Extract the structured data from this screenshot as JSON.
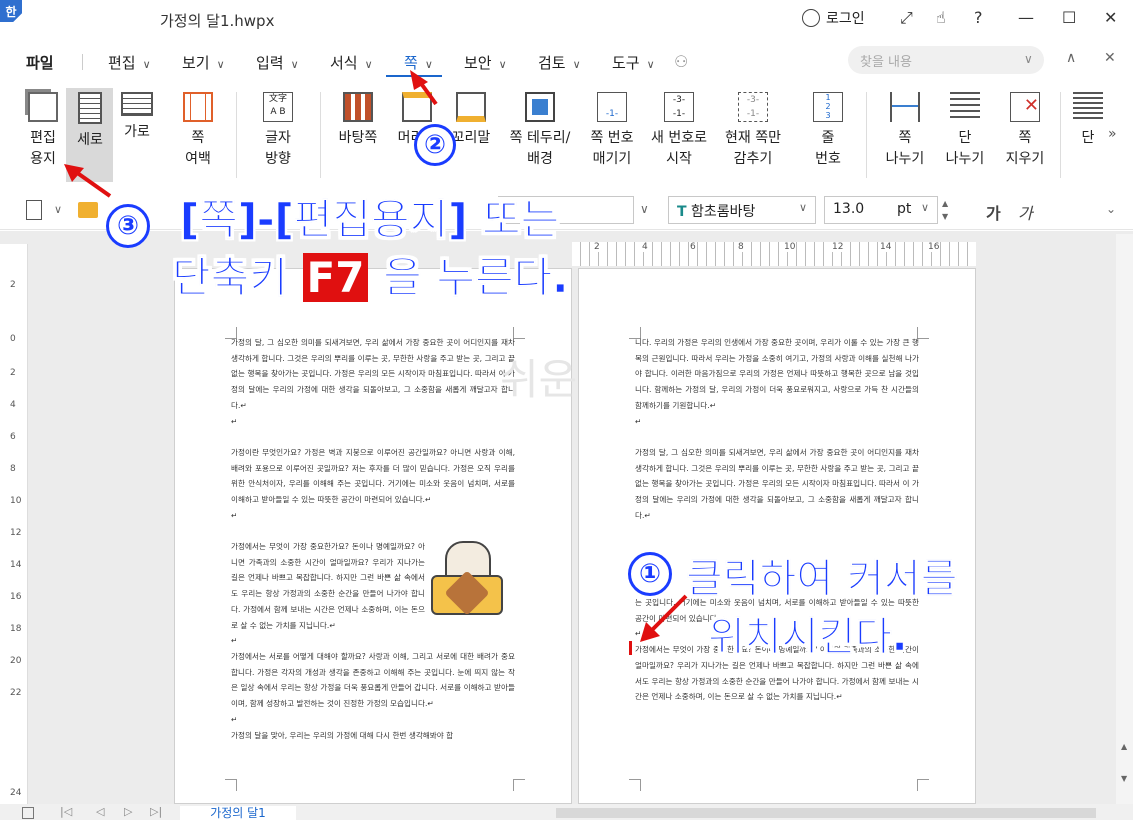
{
  "titlebar": {
    "app_icon": "한",
    "title": "가정의 달1.hwpx",
    "login": "로그인",
    "help": "?"
  },
  "menus": [
    "파일",
    "편집",
    "보기",
    "입력",
    "서식",
    "쪽",
    "보안",
    "검토",
    "도구"
  ],
  "search_placeholder": "찾을 내용",
  "ribbon": {
    "items": [
      {
        "label": "편집\n용지",
        "icon": "edit-paper-icon"
      },
      {
        "label": "세로",
        "icon": "portrait-icon"
      },
      {
        "label": "가로",
        "icon": "landscape-icon"
      },
      {
        "label": "쪽\n여백",
        "icon": "page-margin-icon"
      },
      {
        "label": "글자\n방향",
        "icon": "text-direction-icon"
      },
      {
        "label": "바탕쪽",
        "icon": "master-page-icon"
      },
      {
        "label": "머리말",
        "icon": "header-icon"
      },
      {
        "label": "꼬리말",
        "icon": "footer-icon"
      },
      {
        "label": "쪽 테두리/\n배경",
        "icon": "page-border-icon"
      },
      {
        "label": "쪽 번호\n매기기",
        "icon": "page-number-icon"
      },
      {
        "label": "새 번호로\n시작",
        "icon": "new-number-icon"
      },
      {
        "label": "현재 쪽만\n감추기",
        "icon": "hide-page-icon"
      },
      {
        "label": "줄\n번호",
        "icon": "line-number-icon"
      },
      {
        "label": "쪽\n나누기",
        "icon": "page-break-icon"
      },
      {
        "label": "단\n나누기",
        "icon": "column-break-icon"
      },
      {
        "label": "쪽\n지우기",
        "icon": "delete-page-icon"
      },
      {
        "label": "단",
        "icon": "columns-icon"
      }
    ]
  },
  "format": {
    "font": "함초롬바탕",
    "size": "13.0",
    "unit": "pt",
    "bold": "가",
    "italic": "가"
  },
  "ruler": {
    "h": [
      "2",
      "4",
      "6",
      "8",
      "10",
      "12",
      "14",
      "16"
    ],
    "v": [
      "2",
      "0",
      "2",
      "4",
      "6",
      "8",
      "10",
      "12",
      "14",
      "16",
      "18",
      "20",
      "22",
      "24"
    ]
  },
  "page1": {
    "p1": "가정의 달, 그 심오한 의미를 되새겨보면, 우리 삶에서 가장 중요한 곳이 어디인지를 재차 생각하게 합니다. 그것은 우리의 뿌리를 이루는 곳, 무한한 사랑을 주고 받는 곳, 그리고 끝없는 행복을 찾아가는 곳입니다. 가정은 우리의 모든 시작이자 마침표입니다. 따라서 이 가정의 달에는 우리의 가정에 대한 생각을 되돌아보고, 그 소중함을 새롭게 깨달고자 합니다.↵\n↵",
    "p2": "가정이란 무엇인가요? 가정은 벽과 지붕으로 이루어진 공간일까요? 아니면 사랑과 이해, 배려와 포용으로 이루어진 곳일까요? 저는 후자를 더 많이 믿습니다. 가정은 오직 우리를 위한 안식처이자, 우리를 이해해 주는 곳입니다. 거기에는 미소와 웃음이 넘치며, 서로를 이해하고 받아들일 수 있는 따뜻한 공간이 마련되어 있습니다.↵\n↵",
    "p3": "가정에서는 무엇이 가장 중요한가요? 돈이나 명예일까요? 아니면 가족과의 소중한 시간이 얼마일까요? 우리가 지나가는 길은 언제나 바쁘고 복잡합니다. 하지만 그런 바쁜 삶 속에서도 우리는 항상 가정과의 소중한 순간을 만들어 나가야 합니다. 가정에서 함께 보내는 시간은 언제나 소중하며, 이는 돈으로 살 수 없는 가치를 지닙니다.↵\n↵",
    "p4": "가정에서는 서로를 어떻게 대해야 할까요? 사랑과 이해, 그리고 서로에 대한 배려가 중요합니다. 가정은 각자의 개성과 생각을 존중하고 이해해 주는 곳입니다. 눈에 띄지 않는 작은 일상 속에서 우리는 항상 가정을 더욱 풍요롭게 만들어 갑니다. 서로를 이해하고 받아들이며, 함께 성장하고 발전하는 것이 진정한 가정의 모습입니다.↵\n↵\n가정의 달을 맞아, 우리는 우리의 가정에 대해 다시 한번 생각해봐야 합"
  },
  "page2": {
    "p1": "니다. 우리의 가정은 우리의 인생에서 가장 중요한 곳이며, 우리가 이룰 수 있는 가장 큰 행복의 근원입니다. 따라서 우리는 가정을 소중히 여기고, 가정의 사랑과 이해를 실천해 나가야 합니다. 이러한 마음가짐으로 우리의 가정은 언제나 따뜻하고 행복한 곳으로 남을 것입니다. 함께하는 가정의 달, 우리의 가정이 더욱 풍요로워지고, 사랑으로 가득 찬 시간들의 함께하기를 기원합니다.↵\n↵",
    "p2": "가정의 달, 그 심오한 의미를 되새겨보면, 우리 삶에서 가장 중요한 곳이 어디인지를 재차 생각하게 합니다. 그것은 우리의 뿌리를 이루는 곳, 무한한 사랑을 주고 받는 곳, 그리고 끝없는 행복을 찾아가는 곳입니다. 가정은 우리의 모든 시작이자 마침표입니다. 따라서 이 가정의 달에는 우리의 가정에 대한 생각을 되돌아보고, 그 소중함을 새롭게 깨달고자 합니다.↵",
    "p3": "는 곳입니다. 거기에는 미소와 웃음이 넘치며, 서로를 이해하고 받아들일 수 있는 따뜻한 공간이 마련되어 있습니다.↵\n↵\n가정에서는 무엇이 가장 중요한가요? 돈이나 명예일까요? 아니면 가족과의 소중한 시간이 얼마일까요? 우리가 지나가는 길은 언제나 바쁘고 복잡합니다. 하지만 그런 바쁜 삶 속에서도 우리는 항상 가정과의 소중한 순간을 만들어 나가야 합니다. 가정에서 함께 보내는 시간은 언제나 소중하며, 이는 돈으로 살 수 없는 가치를 지닙니다.↵"
  },
  "watermark": "쉬운",
  "annotations": {
    "step3_line1": "[쪽]-[편집용지] 또는",
    "step3_line2a": "단축키",
    "step3_key": "F7",
    "step3_line2b": "을 누른다.",
    "step1_line1": "클릭하여 커서를",
    "step1_line2": "위치시킨다.",
    "n1": "①",
    "n2": "②",
    "n3": "③"
  },
  "doc_tab": "가정의 달1"
}
